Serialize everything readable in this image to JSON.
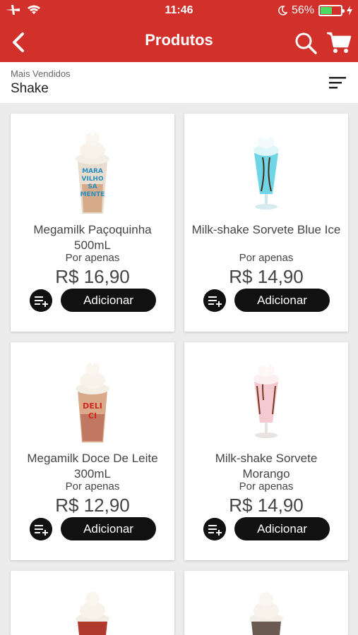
{
  "status_bar": {
    "time": "11:46",
    "battery": "56%",
    "battery_level": 0.56
  },
  "header": {
    "title": "Produtos",
    "icons": [
      "back-arrow-icon",
      "search-icon",
      "cart-icon"
    ]
  },
  "filter": {
    "label": "Mais Vendidos",
    "value": "Shake"
  },
  "products": [
    {
      "name": "Megamilk Paçoquinha 500mL",
      "price_prefix": "Por apenas",
      "price": "R$ 16,90",
      "add_label": "Adicionar"
    },
    {
      "name": "Milk-shake Sorvete Blue Ice",
      "price_prefix": "Por apenas",
      "price": "R$ 14,90",
      "add_label": "Adicionar"
    },
    {
      "name": "Megamilk Doce De Leite 300mL",
      "price_prefix": "Por apenas",
      "price": "R$ 12,90",
      "add_label": "Adicionar"
    },
    {
      "name": "Milk-shake Sorvete Morango",
      "price_prefix": "Por apenas",
      "price": "R$ 14,90",
      "add_label": "Adicionar"
    }
  ],
  "colors": {
    "brand": "#d1302b",
    "button": "#111111"
  }
}
